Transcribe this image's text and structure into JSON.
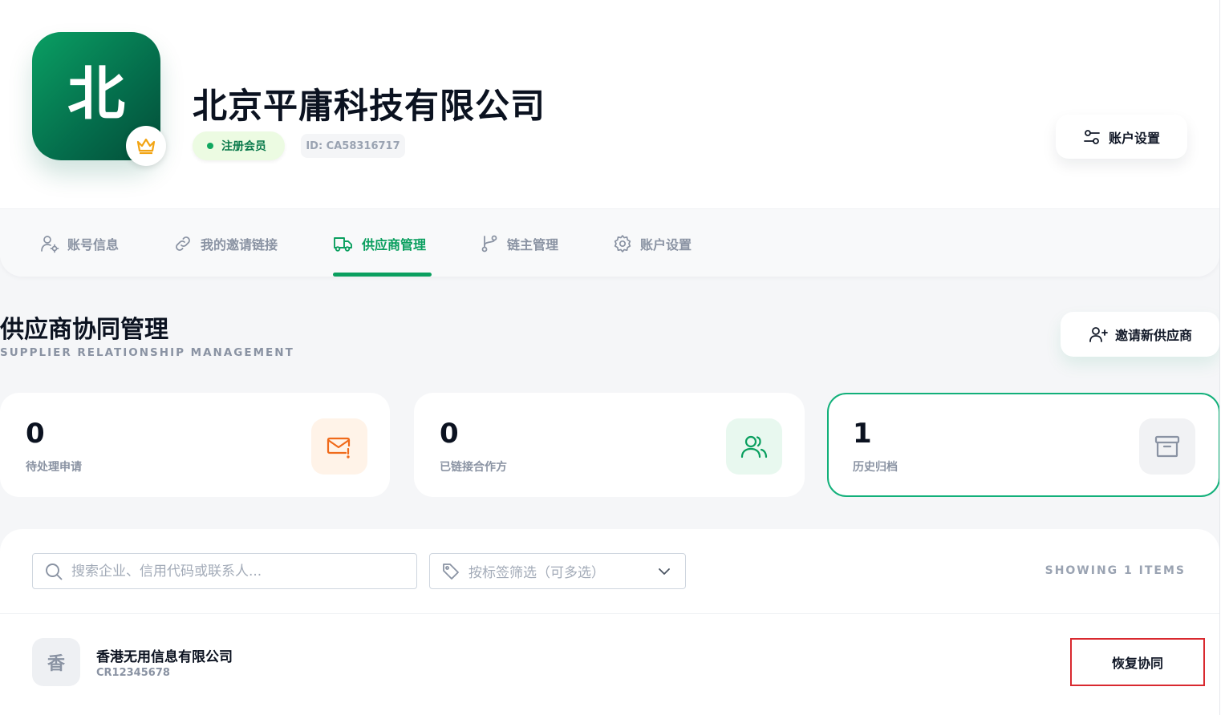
{
  "header": {
    "logo_char": "北",
    "company_name": "北京平庸科技有限公司",
    "member_badge": "注册会员",
    "id_label": "ID: CA58316717",
    "account_settings_label": "账户设置"
  },
  "tabs": [
    {
      "label": "账号信息",
      "icon": "user-gear-icon",
      "active": false
    },
    {
      "label": "我的邀请链接",
      "icon": "link-icon",
      "active": false
    },
    {
      "label": "供应商管理",
      "icon": "truck-icon",
      "active": true
    },
    {
      "label": "链主管理",
      "icon": "branch-icon",
      "active": false
    },
    {
      "label": "账户设置",
      "icon": "gear-icon",
      "active": false
    }
  ],
  "section": {
    "title": "供应商协同管理",
    "subtitle": "SUPPLIER RELATIONSHIP MANAGEMENT",
    "invite_label": "邀请新供应商"
  },
  "stats": [
    {
      "value": "0",
      "label": "待处理申请",
      "icon": "mail-alert-icon"
    },
    {
      "value": "0",
      "label": "已链接合作方",
      "icon": "users-icon"
    },
    {
      "value": "1",
      "label": "历史归档",
      "icon": "archive-icon"
    }
  ],
  "filters": {
    "search_placeholder": "搜索企业、信用代码或联系人...",
    "tag_placeholder": "按标签筛选（可多选）",
    "showing": "SHOWING 1 ITEMS"
  },
  "rows": [
    {
      "avatar": "香",
      "name": "香港无用信息有限公司",
      "code": "CR12345678",
      "action": "恢复协同"
    }
  ],
  "colors": {
    "accent": "#0a9f5f",
    "active_border": "#12b07a",
    "alert_orange": "#f06a1a",
    "danger_border": "#d9292f"
  }
}
